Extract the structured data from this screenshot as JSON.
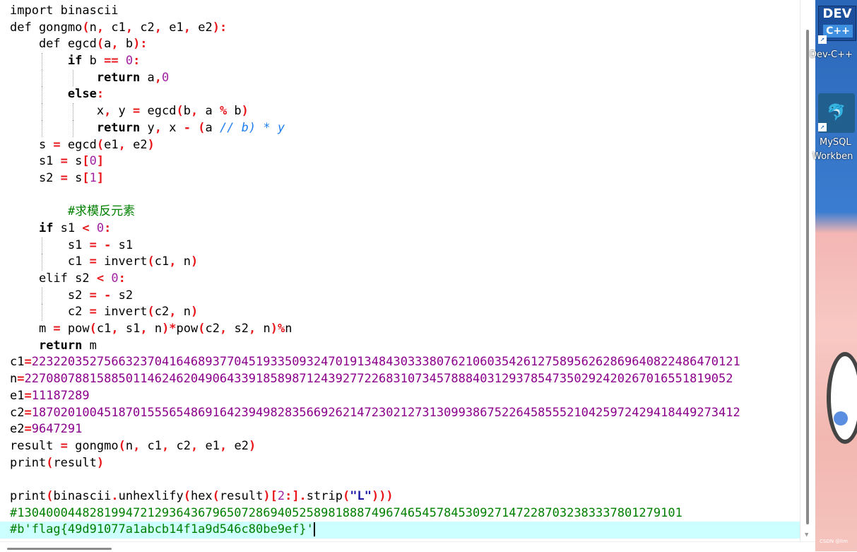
{
  "editor": {
    "lines": [
      "import binascii",
      "def gongmo(n, c1, c2, e1, e2):",
      "    def egcd(a, b):",
      "        if b == 0:",
      "            return a,0",
      "        else:",
      "            x, y = egcd(b, a % b)",
      "            return y, x - (a // b) * y",
      "    s = egcd(e1, e2)",
      "    s1 = s[0]",
      "    s2 = s[1]",
      "",
      "    #求模反元素",
      "    if s1 < 0:",
      "        s1 = - s1",
      "        c1 = invert(c1, n)",
      "    elif s2 < 0:",
      "        s2 = - s2",
      "        c2 = invert(c2, n)",
      "    m = pow(c1, s1, n)*pow(c2, s2, n)%n",
      "    return m",
      "c1=22322035275663237041646893770451933509324701913484303338076210603542612758956262869640822486470121",
      "n=22708078815885011462462049064339185898712439277226831073457888403129378547350292420267016551819052",
      "e1=11187289",
      "c2=18702010045187015556548691642394982835669262147230212731309938675226458555210425972429418449273412",
      "e2=9647291",
      "result = gongmo(n, c1, c2, e1, e2)",
      "print(result)",
      "",
      "print(binascii.unhexlify(hex(result)[2:].strip(\"L\")))",
      "#1304000448281994721293643679650728694052589818887496746545784530927147228703238333780127910​1",
      "#b'flag{49d91077a1abcb14f1a9d546c80be9ef}'"
    ]
  },
  "desktop": {
    "icons": [
      {
        "label": "Dev-C++",
        "icon": "devcpp-icon"
      },
      {
        "label": "MySQL Workbench",
        "icon": "mysql-workbench-icon"
      }
    ],
    "dev_logo_text": "DEV",
    "dev_logo_sub": "C++",
    "mysql_label_1": "MySQL",
    "mysql_label_2": "Workben",
    "dev_label": "Dev-C++",
    "watermark": "CSDN @lim"
  },
  "colors": {
    "operator": "#e8161b",
    "number": "#a020a0",
    "comment": "#008000",
    "string": "#1a1aa6",
    "current_line": "#ccffff"
  }
}
